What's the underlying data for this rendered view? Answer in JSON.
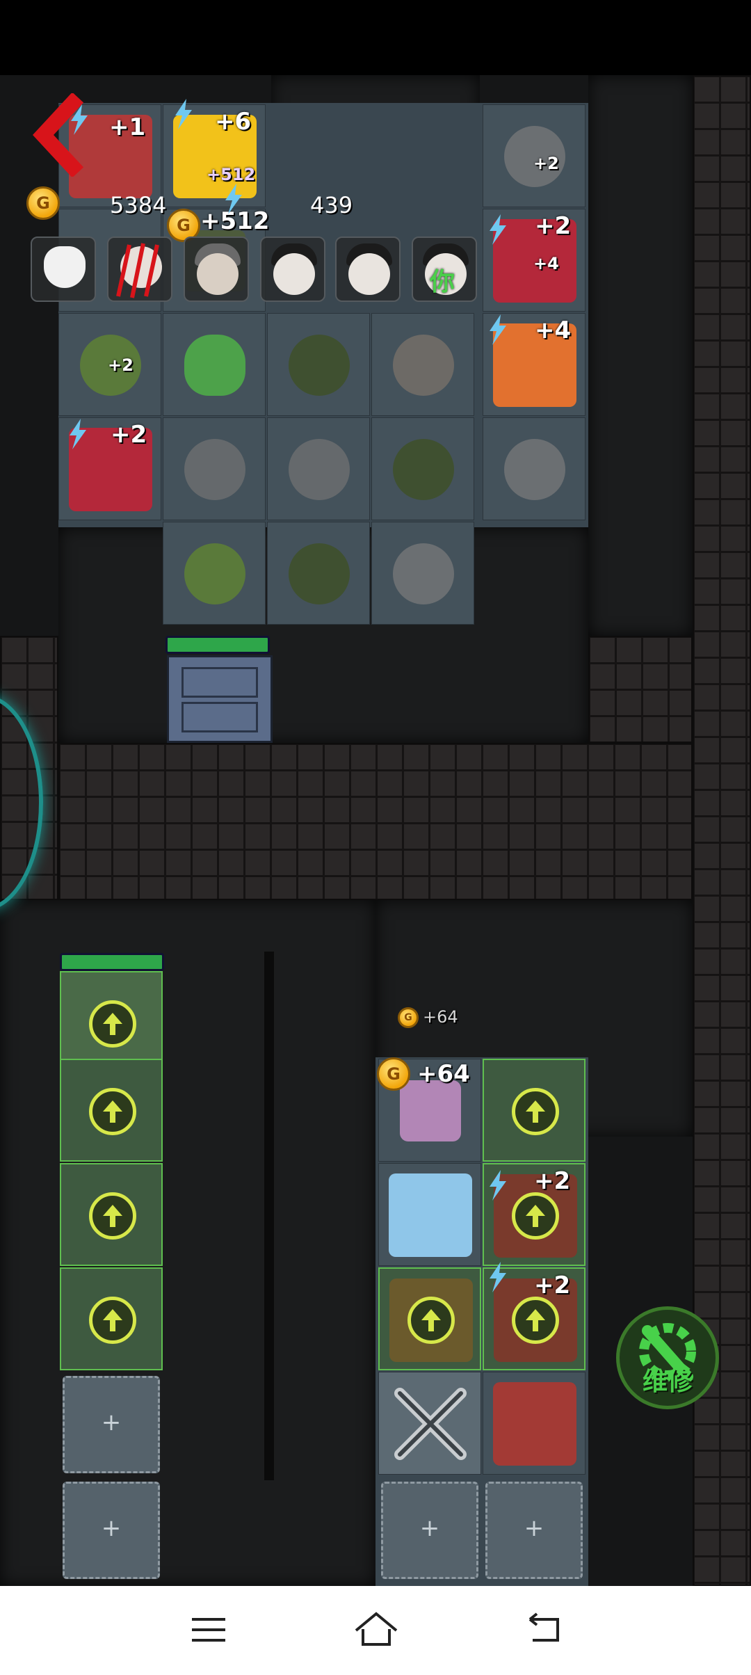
{
  "stats": {
    "coins": "5384",
    "energy": "439",
    "coin_icon": "G"
  },
  "bonuses": {
    "b1": "+1",
    "b2": "+6",
    "b3": "+512",
    "b4": "+512",
    "b5": "+2",
    "b6": "+2",
    "b7": "+4",
    "b8": "+4",
    "b9": "+2",
    "b10": "+2",
    "b11": "+64",
    "b12": "+64",
    "b13": "+2",
    "b14": "+2",
    "b15": "+2"
  },
  "empty_slot_symbol": "+",
  "repair_button": {
    "label": "维修"
  },
  "overlay_text": {
    "you": "你"
  },
  "colors": {
    "accent_green": "#5fbf4f",
    "coin_gold": "#f2a60b",
    "back_red": "#d8141a"
  }
}
